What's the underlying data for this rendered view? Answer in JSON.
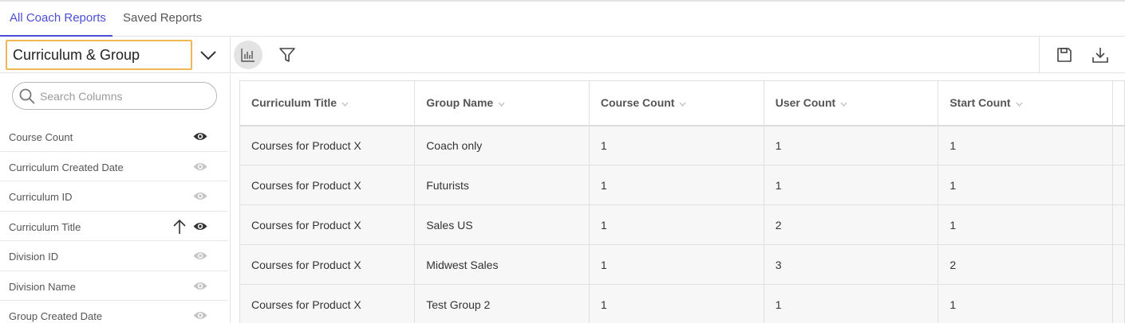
{
  "tabs": [
    {
      "label": "All Coach Reports",
      "active": true
    },
    {
      "label": "Saved Reports",
      "active": false
    }
  ],
  "toolbar": {
    "report_selector": "Curriculum & Group",
    "icons": [
      "chevron-down-icon",
      "bar-chart-icon",
      "filter-icon",
      "save-icon",
      "download-icon"
    ]
  },
  "sidebar": {
    "search_placeholder": "Search Columns",
    "columns": [
      {
        "label": "Course Count",
        "visible": true,
        "sorted_asc": false
      },
      {
        "label": "Curriculum Created Date",
        "visible": false,
        "sorted_asc": false
      },
      {
        "label": "Curriculum ID",
        "visible": false,
        "sorted_asc": false
      },
      {
        "label": "Curriculum Title",
        "visible": true,
        "sorted_asc": true
      },
      {
        "label": "Division ID",
        "visible": false,
        "sorted_asc": false
      },
      {
        "label": "Division Name",
        "visible": false,
        "sorted_asc": false
      },
      {
        "label": "Group Created Date",
        "visible": false,
        "sorted_asc": false
      }
    ]
  },
  "table": {
    "headers": [
      "Curriculum Title",
      "Group Name",
      "Course Count",
      "User Count",
      "Start Count"
    ],
    "rows": [
      [
        "Courses for Product X",
        "Coach only",
        "1",
        "1",
        "1"
      ],
      [
        "Courses for Product X",
        "Futurists",
        "1",
        "1",
        "1"
      ],
      [
        "Courses for Product X",
        "Sales US",
        "1",
        "2",
        "1"
      ],
      [
        "Courses for Product X",
        "Midwest Sales",
        "1",
        "3",
        "2"
      ],
      [
        "Courses for Product X",
        "Test Group 2",
        "1",
        "1",
        "1"
      ]
    ]
  },
  "colors": {
    "accent": "#4b4fd8",
    "selector_border": "#f0b757",
    "row_background": "#f7f7f7",
    "eye_visible": "#333333",
    "eye_hidden": "#c4c4c4"
  }
}
